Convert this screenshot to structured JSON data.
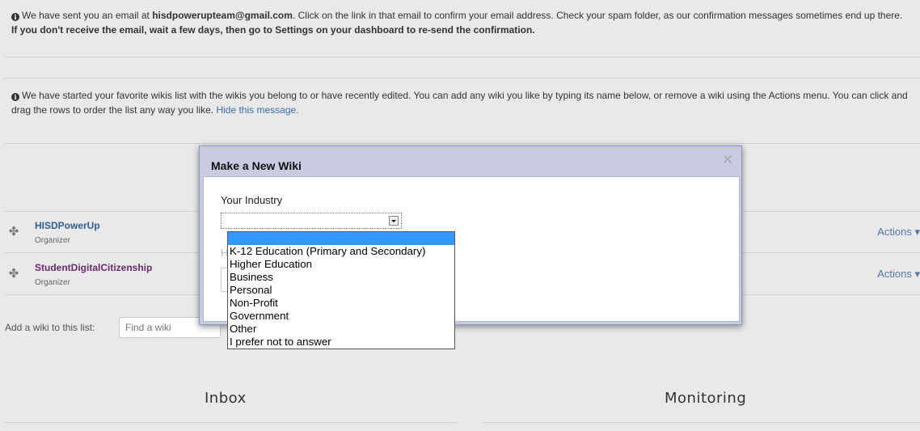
{
  "notices": {
    "email": {
      "text_a": "We have sent you an email at ",
      "email": "hisdpowerupteam@gmail.com",
      "text_b": ". Click on the link in that email to confirm your email address. Check your spam folder, as our confirmation messages sometimes end up there. ",
      "bold_tail": "If you don't receive the email, wait a few days, then go to Settings on your dashboard to re-send the confirmation."
    },
    "favorites": {
      "text": "We have started your favorite wikis list with the wikis you belong to or have recently edited. You can add any wiki you like by typing its name below, or remove a wiki using the Actions menu. You can click and drag the rows to order the list any way you like. ",
      "hide_link": "Hide this message."
    }
  },
  "wikis": [
    {
      "name": "HISDPowerUp",
      "role": "Organizer",
      "actions": "Actions ▾"
    },
    {
      "name": "StudentDigitalCitizenship",
      "role": "Organizer",
      "actions": "Actions ▾"
    }
  ],
  "add_wiki": {
    "label": "Add a wiki to this list:",
    "placeholder": "Find a wiki"
  },
  "sections": {
    "inbox": "Inbox",
    "monitoring": "Monitoring"
  },
  "modal": {
    "title": "Make a New Wiki",
    "close_glyph": "✕",
    "industry_label": "Your Industry",
    "selected_value": "",
    "partial_label": "H"
  },
  "industry_options": [
    "",
    "K-12 Education (Primary and Secondary)",
    "Higher Education",
    "Business",
    "Personal",
    "Non-Profit",
    "Government",
    "Other",
    "I prefer not to answer"
  ],
  "colors": {
    "selected_option": "#3399ff",
    "link": "#3a6fb0",
    "modal_frame": "#c9cbe0"
  },
  "icons": {
    "info": "info-icon",
    "pin": "pin-icon",
    "close": "close-icon",
    "dropdown": "chevron-down-icon"
  }
}
